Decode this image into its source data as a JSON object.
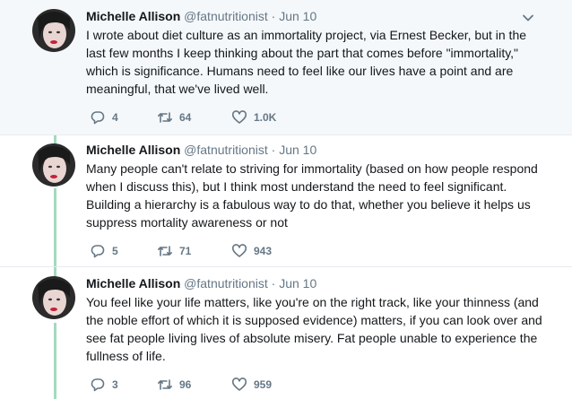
{
  "tweets": [
    {
      "name": "Michelle Allison",
      "handle": "@fatnutritionist",
      "sep": "·",
      "date": "Jun 10",
      "text": "I wrote about diet culture as an immortality project, via Ernest Becker, but in the last few months I keep thinking about the part that comes before \"immortality,\" which is significance. Humans need to feel like our lives have a point and are meaningful, that we've lived well.",
      "replies": "4",
      "retweets": "64",
      "likes": "1.0K"
    },
    {
      "name": "Michelle Allison",
      "handle": "@fatnutritionist",
      "sep": "·",
      "date": "Jun 10",
      "text": "Many people can't relate to striving for immortality (based on how people respond when I discuss this), but I think most understand the need to feel significant. Building a hierarchy is a fabulous way to do that, whether you believe it helps us suppress mortality awareness or not",
      "replies": "5",
      "retweets": "71",
      "likes": "943"
    },
    {
      "name": "Michelle Allison",
      "handle": "@fatnutritionist",
      "sep": "·",
      "date": "Jun 10",
      "text": "You feel like your life matters, like you're on the right track, like your thinness (and the noble effort of which it is supposed evidence) matters, if you can look over and see fat people living lives of absolute misery. Fat people unable to experience the fullness of life.",
      "replies": "3",
      "retweets": "96",
      "likes": "959"
    }
  ],
  "colors": {
    "thread_line": "#a4d9be",
    "highlight_bg": "#f5f8fa",
    "meta": "#657786"
  }
}
